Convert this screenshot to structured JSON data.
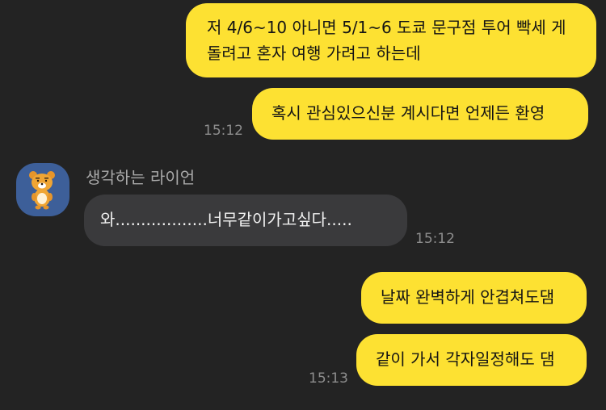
{
  "messages": [
    {
      "text": "저 4/6~10 아니면 5/1~6 도쿄 문구점 투어 빡세 게 돌려고 혼자 여행 가려고 하는데"
    },
    {
      "text": "혹시 관심있으신분 계시다면 언제든 환영",
      "time": "15:12"
    },
    {
      "sender": "생각하는 라이언",
      "text": "와..................너무같이가고싶다.....",
      "time": "15:12"
    },
    {
      "text": "날짜 완벽하게 안겹쳐도댐"
    },
    {
      "text": "같이 가서 각자일정해도 댐",
      "time": "15:13"
    }
  ],
  "colors": {
    "background": "#232323",
    "my_bubble": "#fde132",
    "their_bubble": "#3a3a3c",
    "avatar_bg": "#3d5f99"
  },
  "icons": {
    "avatar": "ryan-character-icon"
  }
}
